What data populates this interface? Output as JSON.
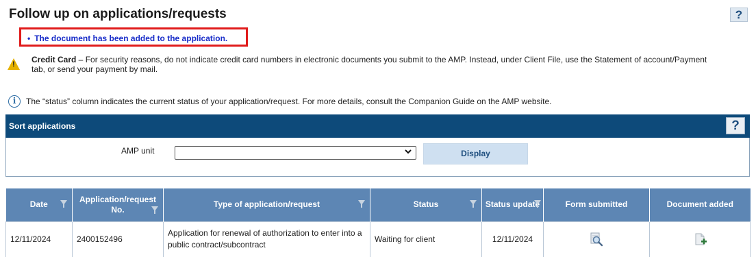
{
  "header": {
    "title": "Follow up on applications/requests",
    "help_label": "?"
  },
  "confirmation": {
    "bullet": "•",
    "message": "The document has been added to the application."
  },
  "notices": {
    "credit_card_title": "Credit Card",
    "credit_card_dash": " – ",
    "credit_card_text": "For security reasons, do not indicate credit card numbers in electronic documents you submit to the AMP. Instead, under Client File, use the Statement of account/Payment tab, or send your payment by mail.",
    "status_note": "The “status” column indicates the current status of your application/request. For more details, consult the Companion Guide on the AMP website.",
    "warning_glyph": "!",
    "info_glyph": "i"
  },
  "sort": {
    "title": "Sort applications",
    "help_label": "?",
    "amp_unit_label": "AMP unit",
    "amp_unit_value": "",
    "display_button": "Display"
  },
  "table": {
    "headers": {
      "date": "Date",
      "number_line1": "Application/request",
      "number_line2": "No.",
      "type": "Type of application/request",
      "status": "Status",
      "status_update": "Status update",
      "form_submitted": "Form submitted",
      "document_added": "Document added"
    },
    "rows": [
      {
        "date": "12/11/2024",
        "number": "2400152496",
        "type": "Application for renewal of authorization to enter into a public contract/subcontract",
        "status": "Waiting for client",
        "status_update": "12/11/2024",
        "form_icon": "magnifier-icon",
        "doc_icon": "add-document-icon"
      }
    ]
  },
  "colors": {
    "sort_bar": "#0d4a7a",
    "table_header": "#5d86b4",
    "confirm_border": "#e01b1b",
    "confirm_text": "#1a2ec9",
    "warning": "#e6b200"
  }
}
